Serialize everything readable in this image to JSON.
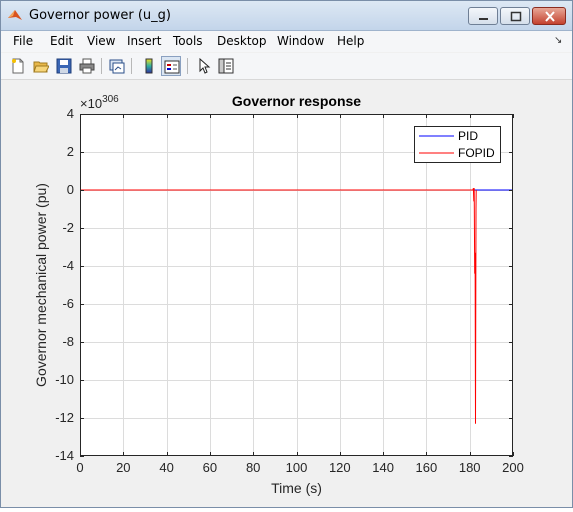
{
  "window": {
    "title": "Governor power (u_g)"
  },
  "menu": [
    "File",
    "Edit",
    "View",
    "Insert",
    "Tools",
    "Desktop",
    "Window",
    "Help"
  ],
  "toolbar": {
    "icons": [
      "new-figure-icon",
      "open-file-icon",
      "save-icon",
      "print-icon",
      "link-plot-icon",
      "insert-colorbar-icon",
      "insert-legend-icon",
      "edit-plot-pointer-icon",
      "property-inspector-icon"
    ]
  },
  "colors": {
    "pid": "#0000ff",
    "fopid": "#ff0000"
  },
  "chart_data": {
    "type": "line",
    "title": "Governor response",
    "xlabel": "Time (s)",
    "ylabel": "Governor mechanical power (pu)",
    "y_exponent": "306",
    "xlim": [
      0,
      200
    ],
    "ylim": [
      -14,
      4
    ],
    "xticks": [
      0,
      20,
      40,
      60,
      80,
      100,
      120,
      140,
      160,
      180,
      200
    ],
    "yticks": [
      4,
      2,
      0,
      -2,
      -4,
      -6,
      -8,
      -10,
      -12,
      -14
    ],
    "grid": true,
    "legend_position": "top-right",
    "series": [
      {
        "name": "PID",
        "color": "#0000ff",
        "x": [
          0,
          182,
          182.5,
          200
        ],
        "y": [
          0,
          0,
          0,
          0
        ]
      },
      {
        "name": "FOPID",
        "color": "#ff0000",
        "x": [
          0,
          181.5,
          181.7,
          181.9,
          182.1,
          182.3,
          182.5,
          182.7,
          182.9,
          183.0
        ],
        "y": [
          0,
          0,
          0.1,
          -0.6,
          0.1,
          -4.4,
          -3.3,
          -12.3,
          -1.0,
          0
        ]
      }
    ]
  }
}
